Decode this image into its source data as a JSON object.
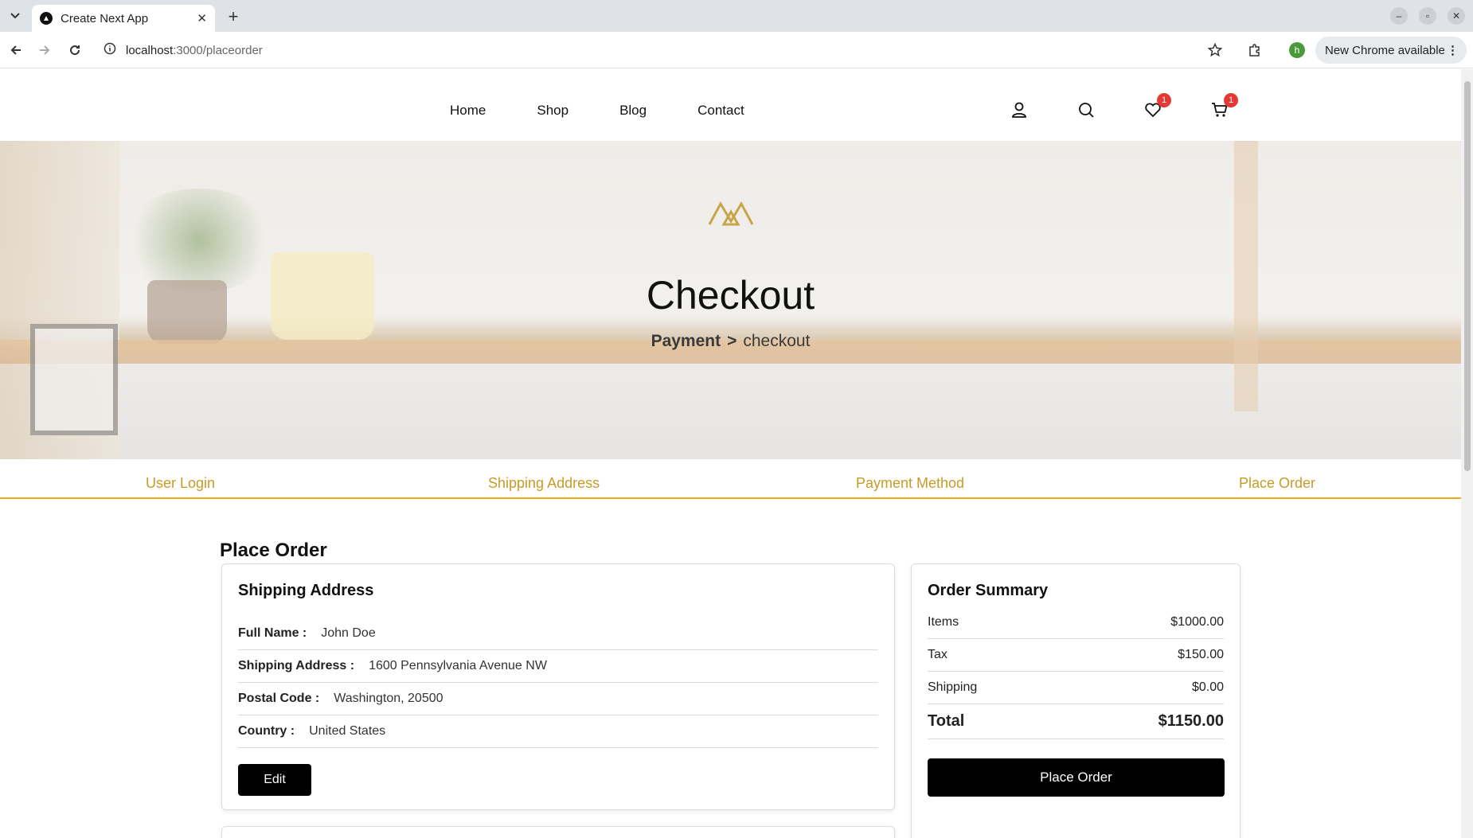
{
  "browser": {
    "tab_title": "Create Next App",
    "url_host": "localhost",
    "url_path": ":3000/placeorder",
    "profile_initial": "h",
    "update_label": "New Chrome available"
  },
  "header": {
    "nav": [
      "Home",
      "Shop",
      "Blog",
      "Contact"
    ],
    "wishlist_count": "1",
    "cart_count": "1"
  },
  "hero": {
    "title": "Checkout",
    "breadcrumb_parent": "Payment",
    "breadcrumb_sep": ">",
    "breadcrumb_current": "checkout"
  },
  "steps": [
    "User Login",
    "Shipping Address",
    "Payment Method",
    "Place Order"
  ],
  "page_heading": "Place Order",
  "shipping": {
    "title": "Shipping Address",
    "fields": [
      {
        "label": "Full Name :",
        "value": "John Doe"
      },
      {
        "label": "Shipping Address :",
        "value": "1600 Pennsylvania Avenue NW"
      },
      {
        "label": "Postal Code :",
        "value": "Washington, 20500"
      },
      {
        "label": "Country :",
        "value": "United States"
      }
    ],
    "edit_label": "Edit"
  },
  "summary": {
    "title": "Order Summary",
    "rows": [
      {
        "label": "Items",
        "value": "$1000.00"
      },
      {
        "label": "Tax",
        "value": "$150.00"
      },
      {
        "label": "Shipping",
        "value": "$0.00"
      }
    ],
    "total_label": "Total",
    "total_value": "$1150.00",
    "place_order_label": "Place Order"
  },
  "colors": {
    "accent": "#f0a81c",
    "step_text": "#c99a27",
    "badge": "#e53935",
    "logo": "#c9a54a"
  }
}
